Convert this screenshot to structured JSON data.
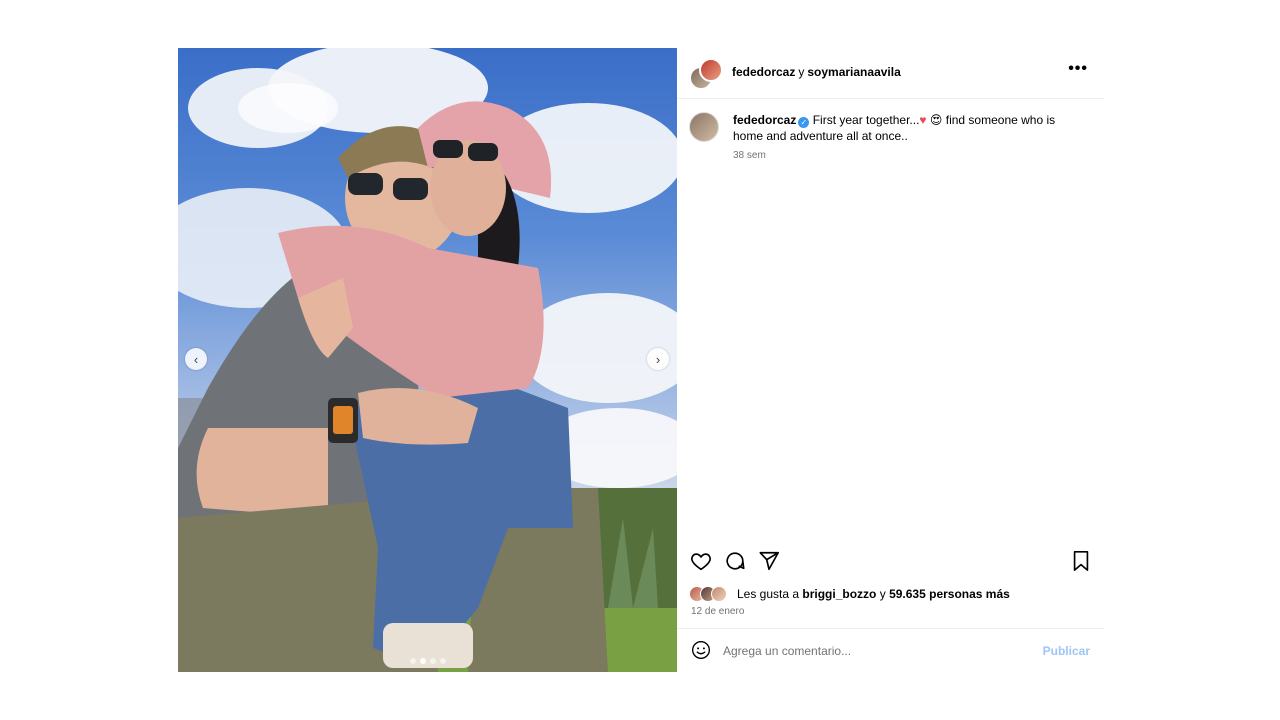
{
  "post": {
    "header": {
      "author": "fededorcaz",
      "connector": "y",
      "coauthor": "soymarianaavila",
      "more_icon": "more-horizontal-icon"
    },
    "caption": {
      "username": "fededorcaz",
      "text_part1": "First year together...",
      "emoji1": "♥",
      "emoji2": "😍",
      "text_part2": "find someone who is home and adventure all at once..",
      "time": "38 sem"
    },
    "actions": {
      "like_icon": "heart-icon",
      "comment_icon": "comment-icon",
      "share_icon": "share-icon",
      "save_icon": "bookmark-icon"
    },
    "likes": {
      "prefix": "Les gusta a",
      "user": "briggi_bozzo",
      "connector": "y",
      "others": "59.635 personas más"
    },
    "date": "12 de enero",
    "comment": {
      "placeholder": "Agrega un comentario...",
      "publish_label": "Publicar"
    },
    "carousel": {
      "prev_label": "‹",
      "next_label": "›",
      "slides": 4,
      "active_slide": 2
    }
  }
}
